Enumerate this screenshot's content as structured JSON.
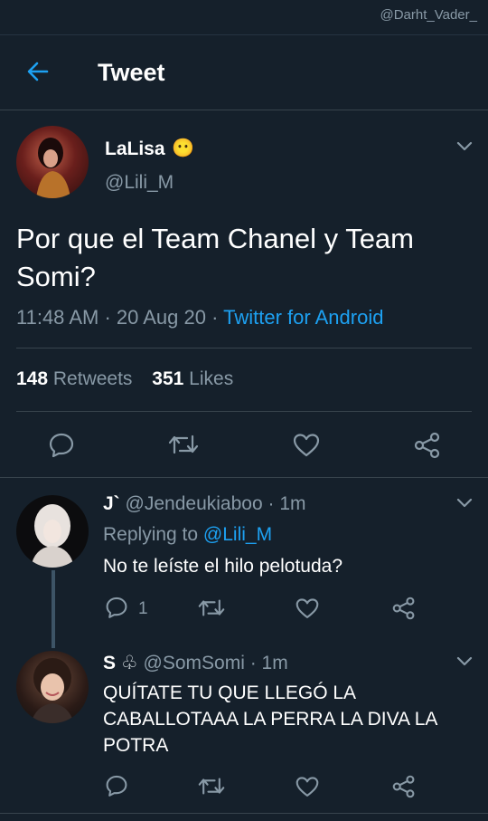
{
  "watermark": "@Darht_Vader_",
  "header": {
    "title": "Tweet"
  },
  "main_tweet": {
    "display_name": "LaLisa",
    "name_emoji": "😶",
    "handle": "@Lili_M",
    "text_line1": "Por que el Team Chanel y Team",
    "text_line2": "Somi?",
    "time": "11:48 AM",
    "date": "20 Aug 20",
    "source": "Twitter for Android",
    "retweets_count": "148",
    "retweets_label": "Retweets",
    "likes_count": "351",
    "likes_label": "Likes"
  },
  "replies": [
    {
      "display_name": "J`",
      "handle": "@Jendeukiaboo",
      "time": "1m",
      "replying_prefix": "Replying to",
      "replying_to": "@Lili_M",
      "text": "No te leíste el hilo pelotuda?",
      "reply_count": "1"
    },
    {
      "display_name": "S",
      "name_emoji": "♧",
      "handle": "@SomSomi",
      "time": "1m",
      "text_line1": "QUÍTATE TU QUE LLEGÓ LA",
      "text_line2": "CABALLOTAAA LA PERRA LA DIVA LA",
      "text_line3": "POTRA"
    }
  ],
  "icons": [
    "back-arrow-icon",
    "chevron-down-icon",
    "reply-icon",
    "retweet-icon",
    "like-icon",
    "share-icon"
  ],
  "colors": {
    "background": "#15202b",
    "accent": "#1da1f2",
    "secondary_text": "#8899a6",
    "divider": "#38444d"
  }
}
